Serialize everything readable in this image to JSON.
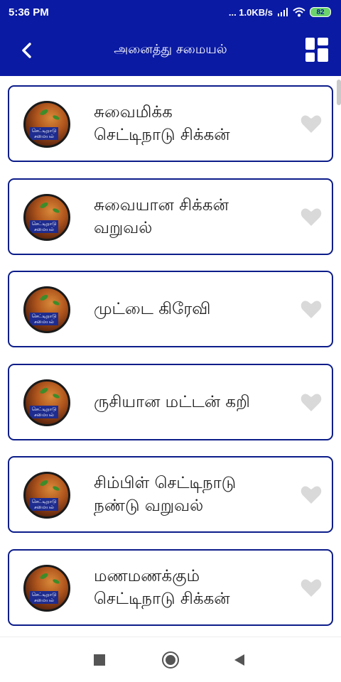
{
  "status_bar": {
    "time": "5:36 PM",
    "network_speed": "... 1.0KB/s",
    "battery": "82"
  },
  "app_bar": {
    "title": "அனைத்து சமையல்",
    "back_icon": "chevron-left-icon",
    "layout_icon": "grid-layout-icon"
  },
  "recipes": [
    {
      "line1": "சுவைமிக்க",
      "line2": "செட்டிநாடு சிக்கன்"
    },
    {
      "line1": "சுவையான சிக்கன்",
      "line2": "வறுவல்"
    },
    {
      "line1": "முட்டை கிரேவி",
      "line2": ""
    },
    {
      "line1": "ருசியான மட்டன் கறி",
      "line2": ""
    },
    {
      "line1": "சிம்பிள் செட்டிநாடு",
      "line2": "நண்டு வறுவல்"
    },
    {
      "line1": "மணமணக்கும்",
      "line2": "செட்டிநாடு சிக்கன்"
    }
  ],
  "thumb_caption": "செட்டிநாடு சமையல்",
  "colors": {
    "primary": "#0a1aa3",
    "card_border": "#0c1d8a",
    "heart": "#d9d9d9"
  },
  "nav_bar": {
    "recents_icon": "square-icon",
    "home_icon": "circle-home-icon",
    "back_icon": "triangle-back-icon"
  }
}
